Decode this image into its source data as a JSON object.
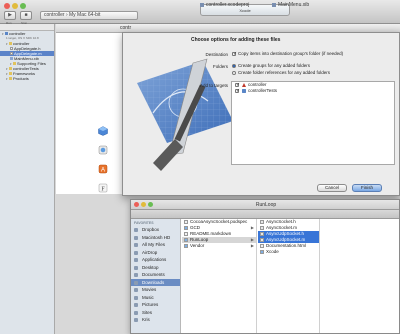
{
  "xcode": {
    "toolbar": {
      "run_label": "Run",
      "stop_label": "Stop",
      "scheme": "controller  ›  My Mac 64-bit",
      "activity_title": "Xcode"
    },
    "tabs": [
      "controller.xcodeproj",
      "MainMenu.xib"
    ],
    "navigator": {
      "items": [
        {
          "label": "controller",
          "kind": "proj",
          "indent": 0,
          "selected": false
        },
        {
          "label": "1 target, OS X SDK 10.8",
          "kind": "sub",
          "indent": 0,
          "selected": false
        },
        {
          "label": "controller",
          "kind": "folder",
          "indent": 1,
          "selected": false
        },
        {
          "label": "AppDelegate.h",
          "kind": "file",
          "indent": 2,
          "selected": false
        },
        {
          "label": "AppDelegate.m",
          "kind": "file",
          "indent": 2,
          "selected": true
        },
        {
          "label": "MainMenu.xib",
          "kind": "xib",
          "indent": 2,
          "selected": false
        },
        {
          "label": "Supporting Files",
          "kind": "folder",
          "indent": 2,
          "selected": false
        },
        {
          "label": "controllerTests",
          "kind": "folder",
          "indent": 1,
          "selected": false
        },
        {
          "label": "Frameworks",
          "kind": "folder",
          "indent": 1,
          "selected": false
        },
        {
          "label": "Products",
          "kind": "folder",
          "indent": 1,
          "selected": false
        }
      ]
    },
    "editor_header": "contr",
    "code_lines": [
      "ect:",
      "ect-40",
      "ndow",
      "Window",
      "=28t"
    ]
  },
  "sheet": {
    "title": "Choose options for adding these files",
    "destination_label": "Destination",
    "destination_option": "Copy items into destination group's folder (if needed)",
    "destination_checked": true,
    "folders_label": "Folders",
    "folder_options": [
      {
        "label": "Create groups for any added folders",
        "selected": true
      },
      {
        "label": "Create folder references for any added folders",
        "selected": false
      }
    ],
    "targets_label": "Add to targets",
    "targets": [
      {
        "label": "controller",
        "checked": true,
        "icon": "app-target-icon",
        "color": "#c0392b"
      },
      {
        "label": "controllerTests",
        "checked": true,
        "icon": "test-target-icon",
        "color": "#5a86c7"
      }
    ],
    "cancel_label": "Cancel",
    "finish_label": "Finish"
  },
  "finder": {
    "title": "RunLoop",
    "sidebar_header": "FAVORITES",
    "sidebar_items": [
      {
        "label": "Dropbox",
        "selected": false
      },
      {
        "label": "Macintosh HD",
        "selected": false
      },
      {
        "label": "All My Files",
        "selected": false
      },
      {
        "label": "AirDrop",
        "selected": false
      },
      {
        "label": "Applications",
        "selected": false
      },
      {
        "label": "Desktop",
        "selected": false
      },
      {
        "label": "Documents",
        "selected": false
      },
      {
        "label": "Downloads",
        "selected": true
      },
      {
        "label": "Movies",
        "selected": false
      },
      {
        "label": "Music",
        "selected": false
      },
      {
        "label": "Pictures",
        "selected": false
      },
      {
        "label": "Sites",
        "selected": false
      },
      {
        "label": "Kris",
        "selected": false
      }
    ],
    "column1": [
      {
        "label": "CocoaAsyncSocket.podspec",
        "kind": "file",
        "state": "none",
        "arrow": false
      },
      {
        "label": "GCD",
        "kind": "folder",
        "state": "none",
        "arrow": true
      },
      {
        "label": "README.markdown",
        "kind": "file",
        "state": "none",
        "arrow": false
      },
      {
        "label": "RunLoop",
        "kind": "folder",
        "state": "sel",
        "arrow": true
      },
      {
        "label": "Vendor",
        "kind": "folder",
        "state": "none",
        "arrow": true
      }
    ],
    "column2": [
      {
        "label": "AsyncSocket.h",
        "kind": "h",
        "state": "none"
      },
      {
        "label": "AsyncSocket.m",
        "kind": "m",
        "state": "none"
      },
      {
        "label": "AsyncUdpSocket.h",
        "kind": "h",
        "state": "hl"
      },
      {
        "label": "AsyncUdpSocket.m",
        "kind": "m",
        "state": "hl"
      },
      {
        "label": "Documentation.html",
        "kind": "html",
        "state": "none"
      },
      {
        "label": "Xcode",
        "kind": "folder",
        "state": "none"
      }
    ]
  }
}
